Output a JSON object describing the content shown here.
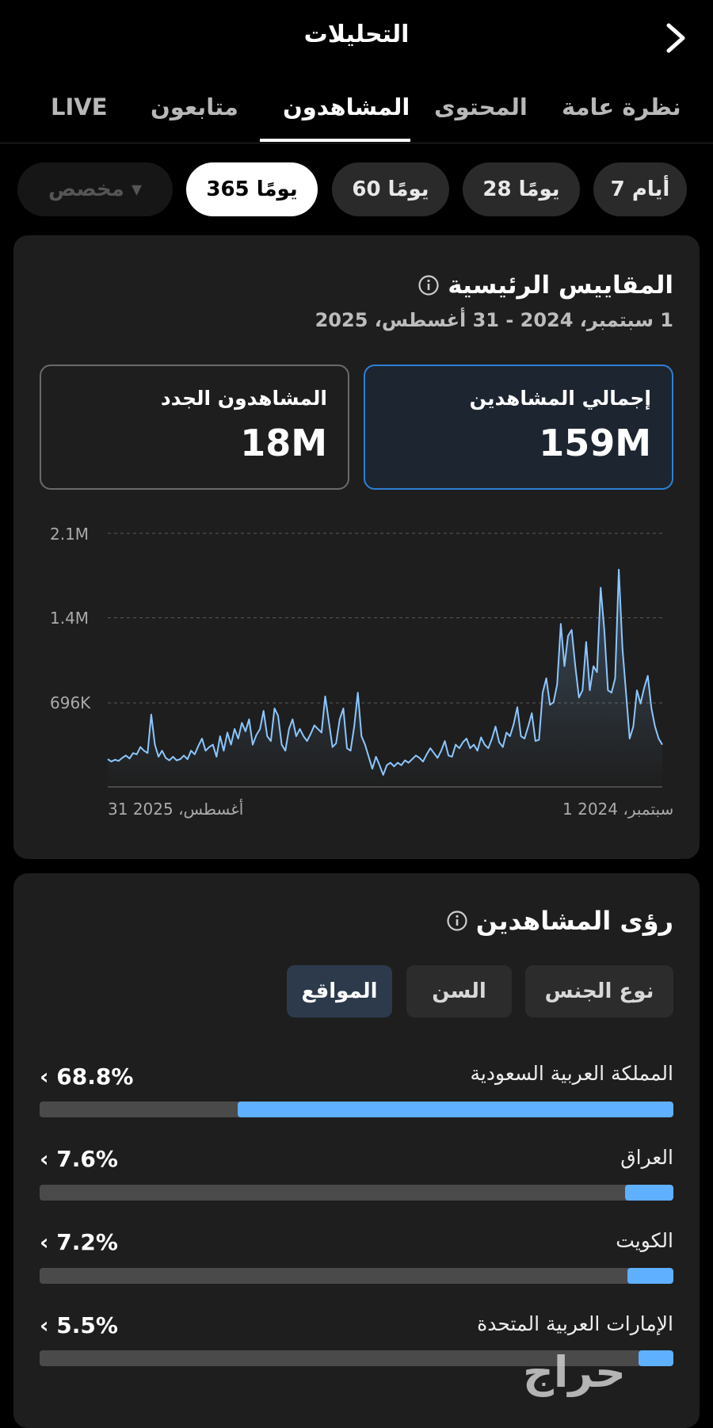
{
  "header": {
    "title": "التحليلات"
  },
  "tabs": [
    {
      "label": "LIVE"
    },
    {
      "label": "متابعون"
    },
    {
      "label": "المشاهدون"
    },
    {
      "label": "المحتوى"
    },
    {
      "label": "نظرة عامة"
    }
  ],
  "active_tab": "المشاهدون",
  "ranges": [
    {
      "label": "مخصص ▾"
    },
    {
      "label": "365 يومًا"
    },
    {
      "label": "60 يومًا"
    },
    {
      "label": "28 يومًا"
    },
    {
      "label": "7 أيام"
    }
  ],
  "metrics": {
    "title": "المقاييس الرئيسية",
    "date_range": "1 سبتمبر، 2024 - 31 أغسطس، 2025",
    "total_viewers": {
      "label": "إجمالي المشاهدين",
      "value": "159M"
    },
    "new_viewers": {
      "label": "المشاهدون الجدد",
      "value": "18M"
    }
  },
  "chart_data": {
    "type": "area",
    "y_ticks": [
      "2.1M",
      "1.4M",
      "696K"
    ],
    "x_start_label": "سبتمبر، 2024 1",
    "x_end_label": "أغسطس، 2025 31",
    "ylim": [
      0,
      2100000
    ],
    "grid": true,
    "line_color": "#8cc6ff",
    "values": [
      230000,
      210000,
      225000,
      215000,
      240000,
      260000,
      235000,
      280000,
      270000,
      330000,
      300000,
      280000,
      600000,
      350000,
      250000,
      300000,
      240000,
      220000,
      250000,
      220000,
      230000,
      260000,
      230000,
      300000,
      270000,
      340000,
      400000,
      300000,
      330000,
      350000,
      250000,
      420000,
      300000,
      450000,
      350000,
      480000,
      400000,
      530000,
      460000,
      560000,
      350000,
      430000,
      480000,
      630000,
      420000,
      380000,
      650000,
      590000,
      350000,
      300000,
      480000,
      560000,
      420000,
      480000,
      420000,
      380000,
      440000,
      510000,
      480000,
      450000,
      750000,
      540000,
      330000,
      360000,
      560000,
      650000,
      320000,
      300000,
      500000,
      780000,
      420000,
      350000,
      250000,
      150000,
      250000,
      180000,
      100000,
      180000,
      200000,
      170000,
      200000,
      180000,
      220000,
      200000,
      230000,
      260000,
      240000,
      210000,
      270000,
      320000,
      280000,
      240000,
      300000,
      380000,
      260000,
      250000,
      350000,
      320000,
      370000,
      400000,
      320000,
      350000,
      300000,
      410000,
      350000,
      320000,
      400000,
      500000,
      370000,
      330000,
      450000,
      420000,
      520000,
      660000,
      420000,
      400000,
      500000,
      610000,
      380000,
      390000,
      780000,
      900000,
      680000,
      700000,
      850000,
      1350000,
      1000000,
      1250000,
      1300000,
      1000000,
      740000,
      800000,
      1200000,
      800000,
      1000000,
      950000,
      1650000,
      1300000,
      800000,
      780000,
      900000,
      1800000,
      1150000,
      780000,
      400000,
      500000,
      800000,
      690000,
      820000,
      920000,
      650000,
      500000,
      400000,
      350000
    ]
  },
  "insights": {
    "title": "رؤى المشاهدين",
    "segments": [
      {
        "label": "نوع الجنس"
      },
      {
        "label": "السن"
      },
      {
        "label": "المواقع"
      }
    ],
    "active_segment": "المواقع",
    "locations": [
      {
        "name": "المملكة العربية السعودية",
        "pct": "68.8%",
        "value": 68.8
      },
      {
        "name": "العراق",
        "pct": "7.6%",
        "value": 7.6
      },
      {
        "name": "الكويت",
        "pct": "7.2%",
        "value": 7.2
      },
      {
        "name": "الإمارات العربية المتحدة",
        "pct": "5.5%",
        "value": 5.5
      }
    ]
  },
  "watermark": "حراج",
  "colors": {
    "accent": "#5fb0ff",
    "active_kpi_border": "#2f7fd6"
  }
}
